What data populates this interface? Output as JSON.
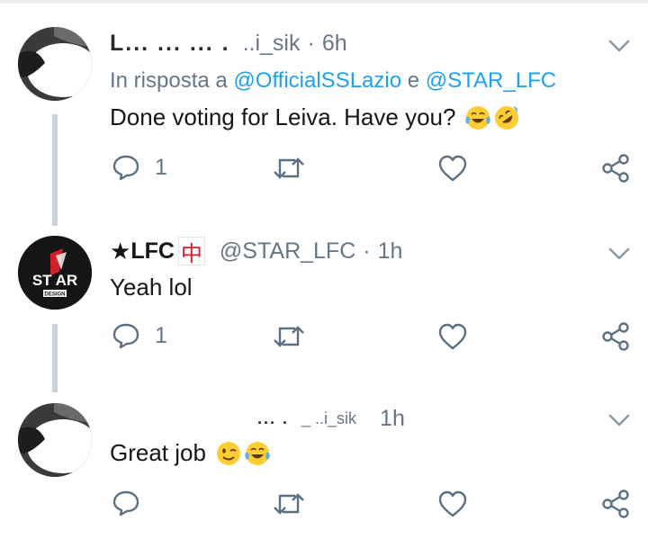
{
  "tweets": [
    {
      "name_redacted": "L... ... ... .",
      "handle": "..i_sik",
      "time": "6h",
      "reply_prefix": "In risposta a",
      "reply_mention_1": "@OfficialSSLazio",
      "reply_join": "e",
      "reply_mention_2": "@STAR_LFC",
      "text": "Done voting for Leiva. Have you?",
      "emojis": [
        "face-with-tears-of-joy",
        "rolling-on-floor-laughing"
      ],
      "reply_count": "1"
    },
    {
      "name": "LFC",
      "handle": "@STAR_LFC",
      "time": "1h",
      "avatar_text": "ST AR",
      "avatar_subtext": "DESIGN",
      "text": "Yeah lol",
      "reply_count": "1"
    },
    {
      "name_redacted": "... .",
      "handle": "_ ..i_sik",
      "time": "1h",
      "text": "Great job",
      "emojis": [
        "winking-face",
        "face-with-tears-of-joy"
      ]
    }
  ],
  "colors": {
    "accent": "#1da1f2",
    "secondary_text": "#657786",
    "thread_line": "#c8d3dc",
    "icon": "#5b7083"
  },
  "icons": [
    "reply-icon",
    "retweet-icon",
    "like-icon",
    "share-icon",
    "chevron-down-icon"
  ]
}
